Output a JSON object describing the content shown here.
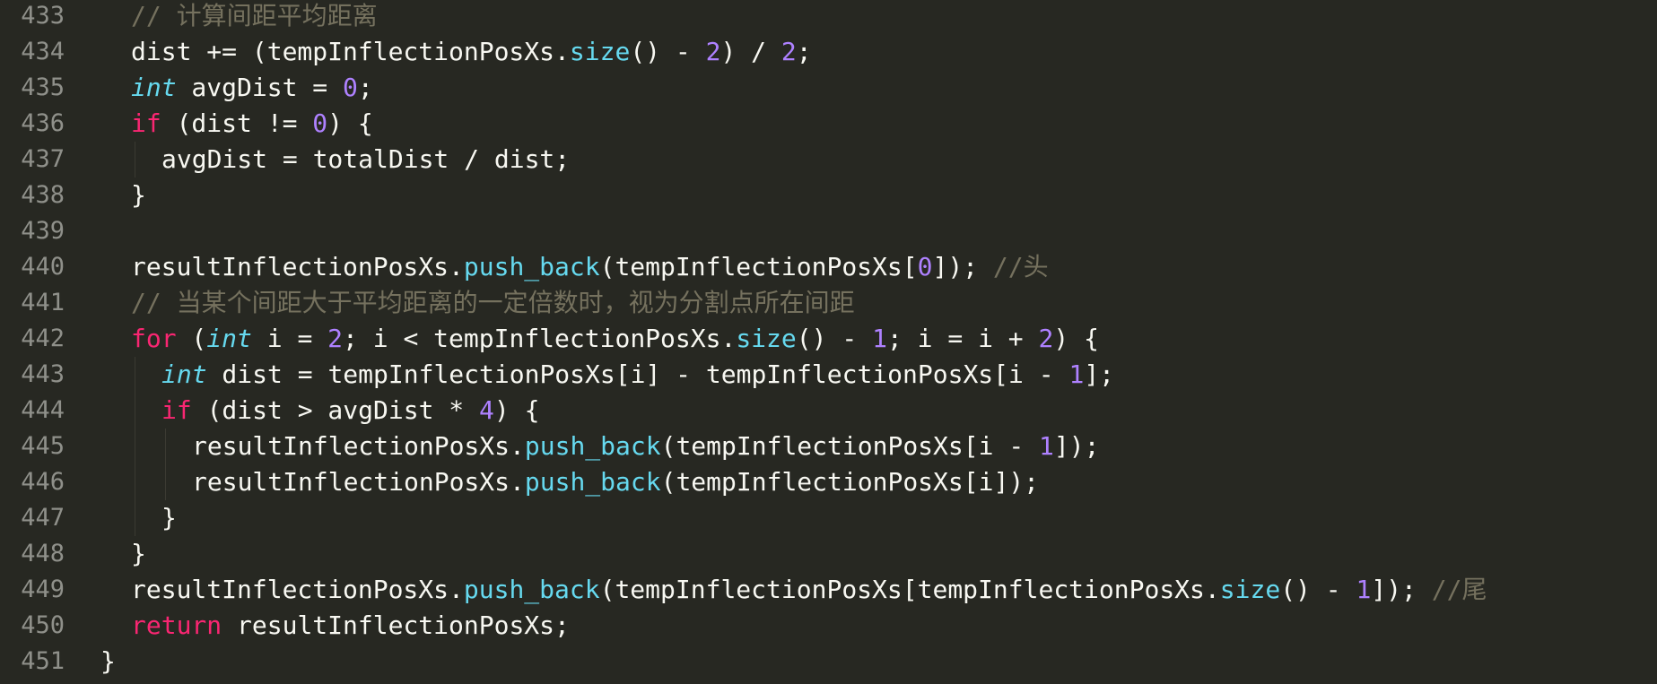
{
  "editor": {
    "theme_colors": {
      "background": "#272822",
      "foreground": "#f8f8f2",
      "line_number": "#8f908a",
      "keyword": "#f92672",
      "type": "#66d9ef",
      "number": "#ae81ff",
      "function": "#66d9ef",
      "comment": "#75715e"
    },
    "lines": [
      {
        "number": "433",
        "indent": 1,
        "tokens": [
          {
            "t": "// 计算间距平均距离",
            "k": "comment"
          }
        ]
      },
      {
        "number": "434",
        "indent": 1,
        "tokens": [
          {
            "t": "dist += (tempInflectionPosXs.",
            "k": "plain"
          },
          {
            "t": "size",
            "k": "func"
          },
          {
            "t": "() - ",
            "k": "plain"
          },
          {
            "t": "2",
            "k": "number"
          },
          {
            "t": ") / ",
            "k": "plain"
          },
          {
            "t": "2",
            "k": "number"
          },
          {
            "t": ";",
            "k": "plain"
          }
        ]
      },
      {
        "number": "435",
        "indent": 1,
        "tokens": [
          {
            "t": "int",
            "k": "type"
          },
          {
            "t": " avgDist = ",
            "k": "plain"
          },
          {
            "t": "0",
            "k": "number"
          },
          {
            "t": ";",
            "k": "plain"
          }
        ]
      },
      {
        "number": "436",
        "indent": 1,
        "tokens": [
          {
            "t": "if",
            "k": "keyword"
          },
          {
            "t": " (dist != ",
            "k": "plain"
          },
          {
            "t": "0",
            "k": "number"
          },
          {
            "t": ") {",
            "k": "plain"
          }
        ]
      },
      {
        "number": "437",
        "indent": 2,
        "tokens": [
          {
            "t": "avgDist = totalDist / dist;",
            "k": "plain"
          }
        ]
      },
      {
        "number": "438",
        "indent": 1,
        "tokens": [
          {
            "t": "}",
            "k": "plain"
          }
        ]
      },
      {
        "number": "439",
        "indent": 1,
        "tokens": []
      },
      {
        "number": "440",
        "indent": 1,
        "tokens": [
          {
            "t": "resultInflectionPosXs.",
            "k": "plain"
          },
          {
            "t": "push_back",
            "k": "func"
          },
          {
            "t": "(tempInflectionPosXs[",
            "k": "plain"
          },
          {
            "t": "0",
            "k": "number"
          },
          {
            "t": "]); ",
            "k": "plain"
          },
          {
            "t": "//头",
            "k": "comment"
          }
        ]
      },
      {
        "number": "441",
        "indent": 1,
        "tokens": [
          {
            "t": "// 当某个间距大于平均距离的一定倍数时，视为分割点所在间距",
            "k": "comment"
          }
        ]
      },
      {
        "number": "442",
        "indent": 1,
        "tokens": [
          {
            "t": "for",
            "k": "keyword"
          },
          {
            "t": " (",
            "k": "plain"
          },
          {
            "t": "int",
            "k": "type"
          },
          {
            "t": " i = ",
            "k": "plain"
          },
          {
            "t": "2",
            "k": "number"
          },
          {
            "t": "; i < tempInflectionPosXs.",
            "k": "plain"
          },
          {
            "t": "size",
            "k": "func"
          },
          {
            "t": "() - ",
            "k": "plain"
          },
          {
            "t": "1",
            "k": "number"
          },
          {
            "t": "; i = i + ",
            "k": "plain"
          },
          {
            "t": "2",
            "k": "number"
          },
          {
            "t": ") {",
            "k": "plain"
          }
        ]
      },
      {
        "number": "443",
        "indent": 2,
        "tokens": [
          {
            "t": "int",
            "k": "type"
          },
          {
            "t": " dist = tempInflectionPosXs[i] - tempInflectionPosXs[i - ",
            "k": "plain"
          },
          {
            "t": "1",
            "k": "number"
          },
          {
            "t": "];",
            "k": "plain"
          }
        ]
      },
      {
        "number": "444",
        "indent": 2,
        "tokens": [
          {
            "t": "if",
            "k": "keyword"
          },
          {
            "t": " (dist > avgDist * ",
            "k": "plain"
          },
          {
            "t": "4",
            "k": "number"
          },
          {
            "t": ") {",
            "k": "plain"
          }
        ]
      },
      {
        "number": "445",
        "indent": 3,
        "tokens": [
          {
            "t": "resultInflectionPosXs.",
            "k": "plain"
          },
          {
            "t": "push_back",
            "k": "func"
          },
          {
            "t": "(tempInflectionPosXs[i - ",
            "k": "plain"
          },
          {
            "t": "1",
            "k": "number"
          },
          {
            "t": "]);",
            "k": "plain"
          }
        ]
      },
      {
        "number": "446",
        "indent": 3,
        "tokens": [
          {
            "t": "resultInflectionPosXs.",
            "k": "plain"
          },
          {
            "t": "push_back",
            "k": "func"
          },
          {
            "t": "(tempInflectionPosXs[i]);",
            "k": "plain"
          }
        ]
      },
      {
        "number": "447",
        "indent": 2,
        "tokens": [
          {
            "t": "}",
            "k": "plain"
          }
        ]
      },
      {
        "number": "448",
        "indent": 1,
        "tokens": [
          {
            "t": "}",
            "k": "plain"
          }
        ]
      },
      {
        "number": "449",
        "indent": 1,
        "tokens": [
          {
            "t": "resultInflectionPosXs.",
            "k": "plain"
          },
          {
            "t": "push_back",
            "k": "func"
          },
          {
            "t": "(tempInflectionPosXs[tempInflectionPosXs.",
            "k": "plain"
          },
          {
            "t": "size",
            "k": "func"
          },
          {
            "t": "() - ",
            "k": "plain"
          },
          {
            "t": "1",
            "k": "number"
          },
          {
            "t": "]); ",
            "k": "plain"
          },
          {
            "t": "//尾",
            "k": "comment"
          }
        ]
      },
      {
        "number": "450",
        "indent": 1,
        "tokens": [
          {
            "t": "return",
            "k": "keyword"
          },
          {
            "t": " resultInflectionPosXs;",
            "k": "plain"
          }
        ]
      },
      {
        "number": "451",
        "indent": 0,
        "tokens": [
          {
            "t": "}",
            "k": "plain"
          }
        ]
      }
    ]
  }
}
